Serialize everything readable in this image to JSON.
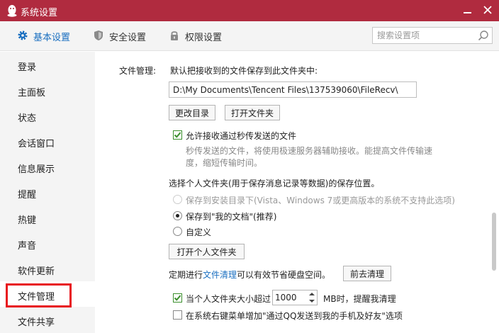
{
  "window": {
    "title": "系统设置",
    "accent_color": "#b02b3f",
    "icons": {
      "app": "qq-penguin-icon",
      "minimize": "minimize-icon",
      "close": "close-icon"
    }
  },
  "tabs": [
    {
      "label": "基本设置",
      "icon": "gear-icon",
      "active": true
    },
    {
      "label": "安全设置",
      "icon": "shield-icon",
      "active": false
    },
    {
      "label": "权限设置",
      "icon": "lock-icon",
      "active": false
    }
  ],
  "search": {
    "placeholder": "搜索设置项",
    "value": "",
    "icon": "search-icon"
  },
  "sidebar": {
    "items": [
      {
        "label": "登录"
      },
      {
        "label": "主面板"
      },
      {
        "label": "状态"
      },
      {
        "label": "会话窗口"
      },
      {
        "label": "信息展示"
      },
      {
        "label": "提醒"
      },
      {
        "label": "热键"
      },
      {
        "label": "声音"
      },
      {
        "label": "软件更新"
      },
      {
        "label": "文件管理",
        "selected": true
      },
      {
        "label": "文件共享"
      }
    ],
    "highlight_color": "#e8141c"
  },
  "file_management": {
    "section_label": "文件管理:",
    "save_folder_desc": "默认把接收到的文件保存到此文件夹中:",
    "save_path": "D:\\My Documents\\Tencent Files\\137539060\\FileRecv\\",
    "change_dir_button": "更改目录",
    "open_folder_button": "打开文件夹",
    "instant_send": {
      "label": "允许接收通过秒传发送的文件",
      "checked": true,
      "desc_line1": "秒传发送的文件，将使用极速服务器辅助接收。能提高文件传输速",
      "desc_line2": "度，缩短传输时间。"
    },
    "personal_folder": {
      "heading": "选择个人文件夹(用于保存消息记录等数据)的保存位置。",
      "options": [
        {
          "label": "保存到安装目录下(Vista、Windows 7或更高版本的系统不支持此选项)",
          "disabled": true,
          "checked": false
        },
        {
          "label": "保存到\"我的文档\"(推荐)",
          "disabled": false,
          "checked": true
        },
        {
          "label": "自定义",
          "disabled": false,
          "checked": false
        }
      ],
      "open_button": "打开个人文件夹"
    },
    "cleanup": {
      "text_before": "定期进行",
      "link": "文件清理",
      "text_after": "可以有效节省硬盘空间。",
      "button": "前去清理"
    },
    "size_limit": {
      "label_before": "当个人文件夹大小超过",
      "value": "1000",
      "label_after": "MB时，提醒我清理",
      "checked": true
    },
    "context_menu": {
      "label": "在系统右键菜单增加\"通过QQ发送到我的手机及好友\"选项",
      "checked": false
    }
  }
}
